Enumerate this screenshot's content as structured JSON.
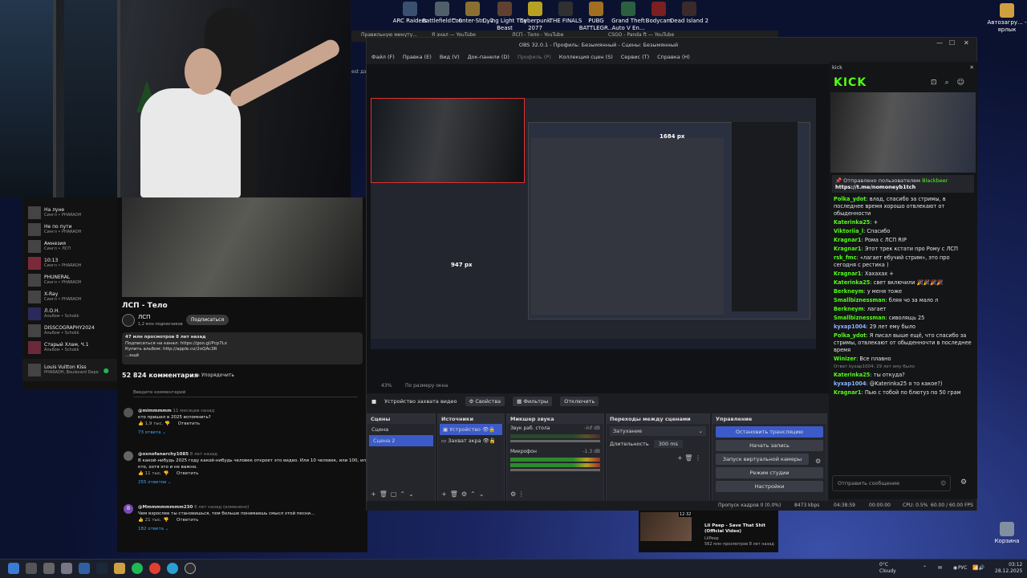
{
  "desktop": {
    "icons": [
      {
        "label": "ARC Raiders",
        "color": "#3a5070"
      },
      {
        "label": "Battlefield™ 6",
        "color": "#50606a"
      },
      {
        "label": "Counter-Str... 2",
        "color": "#8a7030"
      },
      {
        "label": "Dying Light The Beast",
        "color": "#604030"
      },
      {
        "label": "Cyberpunk 2077",
        "color": "#b8a020"
      },
      {
        "label": "THE FINALS",
        "color": "#303030"
      },
      {
        "label": "PUBG BATTLEGR...",
        "color": "#a07020"
      },
      {
        "label": "Grand Theft Auto V En...",
        "color": "#2a6040"
      },
      {
        "label": "Bodycam",
        "color": "#7a2020"
      },
      {
        "label": "Dead Island 2",
        "color": "#3a2a2a"
      },
      {
        "label": "Автозагру... - ярлык",
        "color": "#d0a040"
      }
    ],
    "recycle_bin": "Корзина"
  },
  "spotify": {
    "items": [
      {
        "title": "На луне",
        "sub": "Сингл • PHARAOH"
      },
      {
        "title": "Не по пути",
        "sub": "Сингл • PHARAOH"
      },
      {
        "title": "Амнезия",
        "sub": "Сингл • ЛСП"
      },
      {
        "title": "10:13",
        "sub": "Сингл • PHARAOH"
      },
      {
        "title": "PHUNERAL",
        "sub": "Сингл • PHARAOH"
      },
      {
        "title": "X-Ray",
        "sub": "Сингл • PHARAOH"
      },
      {
        "title": "Л.О.Н.",
        "sub": "Альбом • Schokk"
      },
      {
        "title": "DISSCOGRAPHY2024",
        "sub": "Альбом • Schokk"
      },
      {
        "title": "Старый Хлам, Ч.1",
        "sub": "Альбом • Schokk"
      }
    ],
    "now_playing": {
      "title": "Louis Vuitton Kiss",
      "sub": "PHARAOH, Boulevard Depo"
    }
  },
  "youtube": {
    "title": "ЛСП - Тело",
    "channel": "ЛСП",
    "subs": "1,2 млн подписчиков",
    "subscribe": "Подписаться",
    "desc_line1": "47 млн просмотров  8 лет назад",
    "desc_line2": "Подписаться на канал: https://goo.gl/Pcp7Lx",
    "desc_line3": "Купить альбом: http://apple.co/2oQAc3R",
    "desc_more": "...ещё",
    "comments_count": "52 824 комментария",
    "sort": "Упорядочить",
    "add_comment": "Введите комментарий",
    "comments": [
      {
        "user": "@mimmmmm",
        "time": "11 месяцев назад",
        "text": "кто пришел в 2025 вспомнить?",
        "likes": "1,9 тыс.",
        "reply": "Ответить",
        "answers": "73 ответа"
      },
      {
        "user": "@oxnofanarchy1085",
        "time": "8 лет назад",
        "text": "В какой-нибудь 2025 году какой-нибудь человек откроет это видео. Или 10 человек, или 100, или 1000, или 1...",
        "text2": "кто, хотя это и не важно.",
        "likes": "11 тыс.",
        "reply": "Ответить",
        "answers": "255 ответов"
      },
      {
        "user": "@Мmmmmmmmm230",
        "time": "6 лет назад (изменено)",
        "text": "Чем взрослее ты становишься, тем больше понимаешь смысл этой песни...",
        "likes": "21 тыс.",
        "reply": "Ответить",
        "answers": "182 ответа"
      }
    ],
    "rec_title": "Lil Peep - Save That Shit (Official Video)",
    "rec_channel": "LilPeep",
    "rec_meta": "562 млн просмотров  8 лет назад",
    "rec_time": "12:32"
  },
  "browser": {
    "tabs": [
      "Правильную минуту...",
      "Я знал — YouTube",
      "ЛСП - Тело - YouTube",
      "CSGO - Panda ft — YouTube"
    ],
    "side_text": "est дз"
  },
  "obs": {
    "title": "OBS 32.0.1 - Профиль: Безымянный - Сцены: Безымянный",
    "menu": [
      "Файл (F)",
      "Правка (E)",
      "Вид (V)",
      "Док-панели (D)",
      "Профиль (P)",
      "Коллекция сцен (S)",
      "Сервис (T)",
      "Справка (H)"
    ],
    "preview_px_1": "1684 px",
    "preview_px_2": "947 px",
    "zoom": "43%",
    "fit": "По размеру окна",
    "source_bar": {
      "source": "Устройство захвата видео",
      "props": "Свойства",
      "filters": "Фильтры",
      "off": "Отключить"
    },
    "scenes": {
      "header": "Сцены",
      "items": [
        "Сцена",
        "Сцена 2"
      ]
    },
    "sources": {
      "header": "Источники",
      "items": [
        "Устройство",
        "Захват экра"
      ]
    },
    "mixer": {
      "header": "Микшер звука",
      "ch1": "Звук раб. стола",
      "ch1_db": "-inf dB",
      "ch2": "Микрофон",
      "ch2_db": "-1.3 dB"
    },
    "transitions": {
      "header": "Переходы между сценами",
      "type": "Затухание",
      "duration_label": "Длительность",
      "duration": "300 ms"
    },
    "controls": {
      "header": "Управление",
      "stop": "Остановить трансляцию",
      "record": "Начать запись",
      "virtualcam": "Запуск виртуальной камеры",
      "studio": "Режим студии",
      "settings": "Настройки"
    },
    "status": {
      "dropped": "Пропуск кадров 0 (0.0%)",
      "kbps": "8473 kbps",
      "live": "04:38:59",
      "rec": "00:00:00",
      "cpu": "CPU: 0.5%",
      "fps": "60.00 / 60.00 FPS"
    }
  },
  "kick": {
    "window_title": "kick",
    "logo": "KICK",
    "pinned_by": "Отправлено пользователем",
    "pinned_user": "Blackbeer",
    "pinned_link": "https://t.me/nomoneyb1tch",
    "messages": [
      {
        "user": "Polka_ydot",
        "text": "влад, спасибо за стримы, в последнее время хорошо отвлекают от обыденности"
      },
      {
        "user": "Katerinka25",
        "text": "+"
      },
      {
        "user": "Viktoriia_l",
        "text": "Спасибо"
      },
      {
        "user": "Kragnar1",
        "text": "Рома с ЛСП RIP"
      },
      {
        "user": "Kragnar1",
        "text": "Этот трек кстати про Рому с ЛСП"
      },
      {
        "user": "rsk_fmc",
        "text": "«лагает ебучий стрим», это про сегодня с рестика )"
      },
      {
        "user": "Kragnar1",
        "text": "Хахахах +"
      },
      {
        "user": "Katerinka25",
        "text": "свет включили 🎉🎉🎉🎉"
      },
      {
        "user": "Berkneym",
        "text": "у меня тоже"
      },
      {
        "user": "Smallbiznessman",
        "text": "бляя чо за мало л"
      },
      {
        "user": "Berkneym",
        "text": "лагает"
      },
      {
        "user": "Smallbiznessman",
        "text": "сиволящь 25"
      },
      {
        "user": "kyxap1004",
        "text": "29 лет ему было"
      },
      {
        "user": "Polka_ydot",
        "text": "Я писал выше ещё, что спасибо за стримы, отвлекают от обыденночти в последнее время"
      },
      {
        "user": "Winizer",
        "text": "Все плавно"
      },
      {
        "user": "Katerinka25",
        "text": "ты откуда?",
        "reply": "Ответ kyxap1004: 29 лет ему было"
      },
      {
        "user": "kyxap1004",
        "text": "@Katerinka25 я то какое?)"
      },
      {
        "user": "Kragnar1",
        "text": "Пью с тобой по блютуз по 50 грам"
      }
    ],
    "input_placeholder": "Отправить сообщение"
  },
  "taskbar": {
    "weather_temp": "0°C",
    "weather": "Cloudy",
    "lang": "РУС",
    "time": "03:12",
    "date": "28.12.2025"
  }
}
